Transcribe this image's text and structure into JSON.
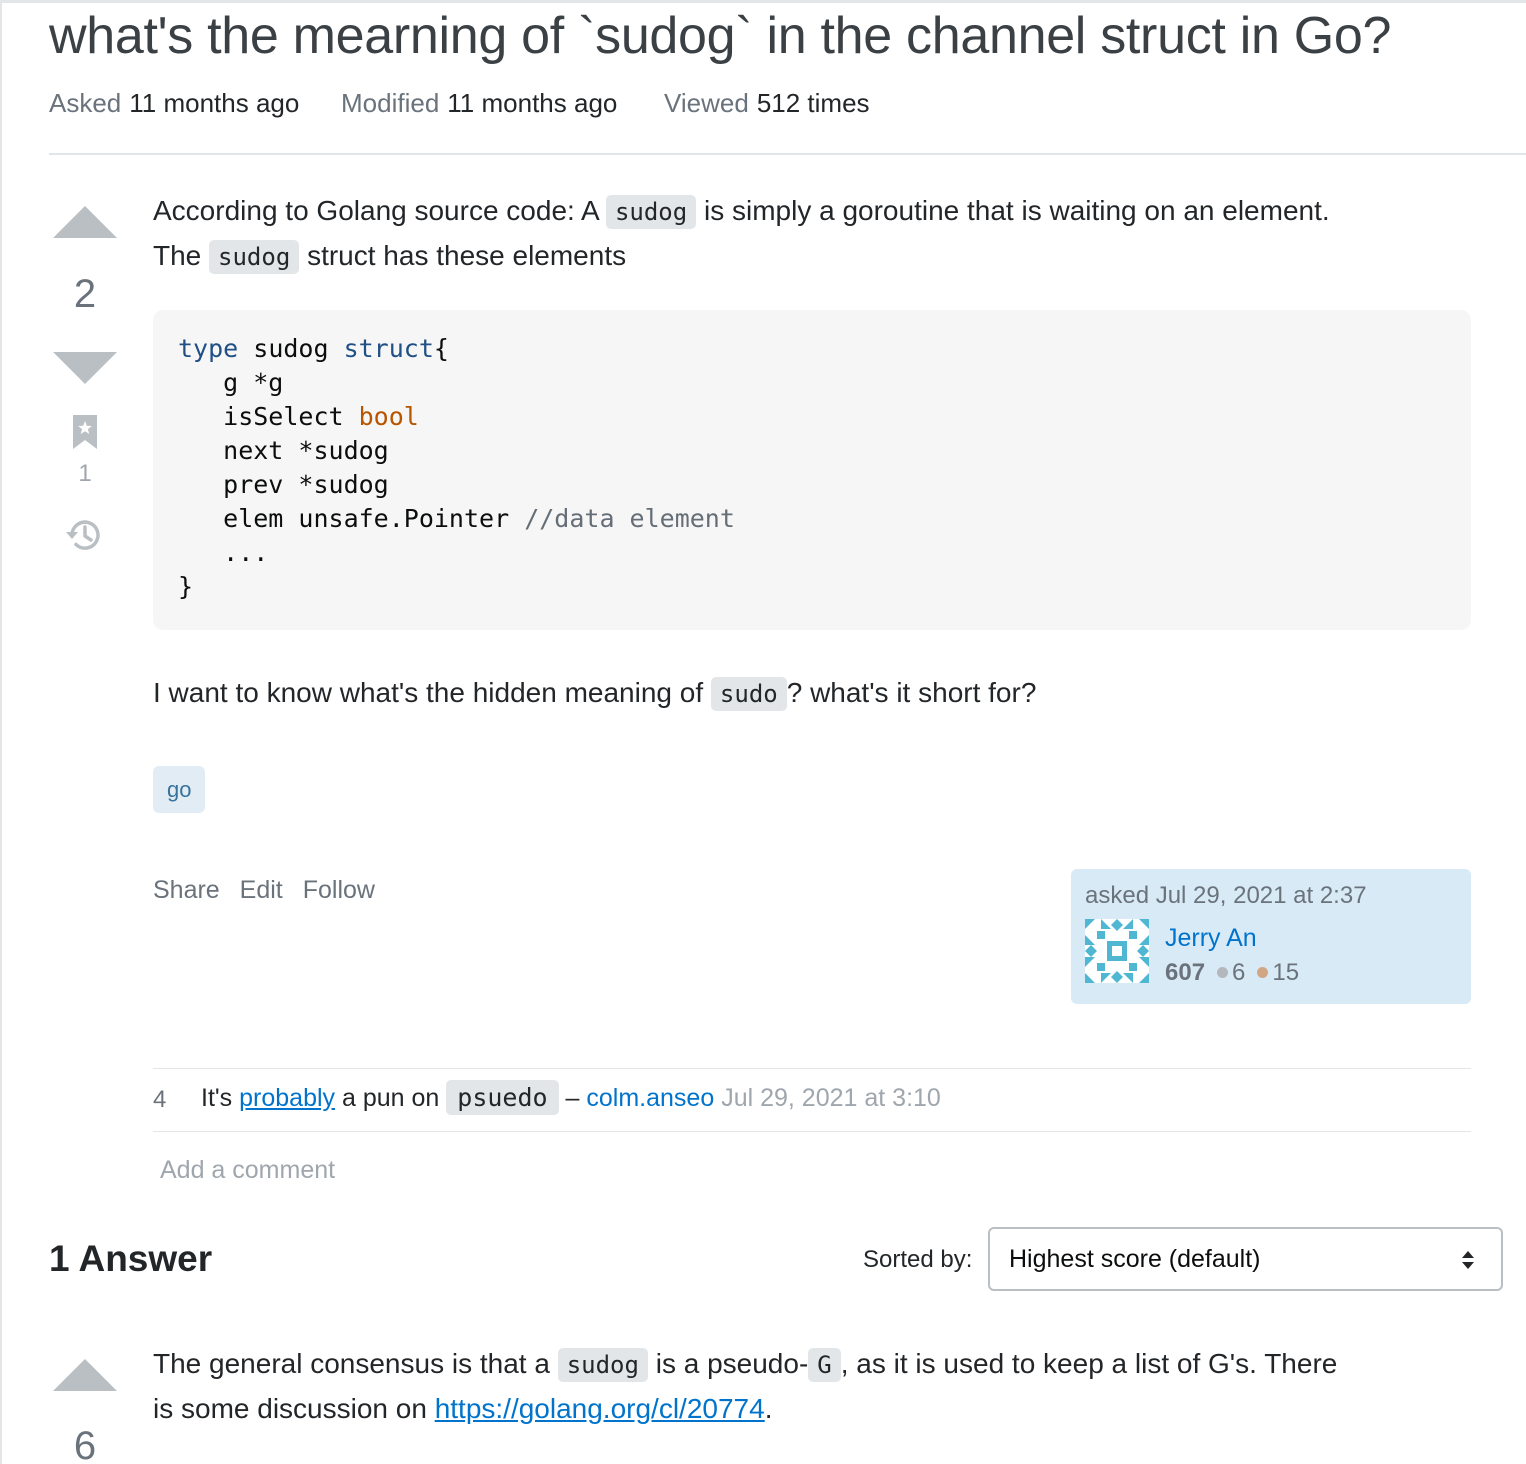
{
  "question": {
    "title": "what's the mearning of `sudog` in the channel struct in Go?",
    "meta": {
      "asked_label": "Asked",
      "asked_value": "11 months ago",
      "modified_label": "Modified",
      "modified_value": "11 months ago",
      "viewed_label": "Viewed",
      "viewed_value": "512 times"
    },
    "vote_count": "2",
    "bookmark_count": "1",
    "body": {
      "p1_a": "According to Golang source code: A",
      "p1_code": "sudog",
      "p1_b": "is simply a goroutine that is waiting on an element.",
      "p2_a": "The",
      "p2_code": "sudog",
      "p2_b": "struct has these elements",
      "code": {
        "l1_kw1": "type",
        "l1_name": " sudog ",
        "l1_kw2": "struct",
        "l1_end": "{",
        "l2": "   g *g",
        "l3_a": "   isSelect ",
        "l3_type": "bool",
        "l4": "   next *sudog",
        "l5": "   prev *sudog",
        "l6_a": "   elem unsafe.Pointer ",
        "l6_comment": "//data element",
        "l7": "   ...",
        "l8": "}"
      },
      "p3_a": "I want to know what's the hidden meaning of",
      "p3_code": "sudo",
      "p3_b": "? what's it short for?"
    },
    "tags": [
      "go"
    ],
    "menu": {
      "share": "Share",
      "edit": "Edit",
      "follow": "Follow"
    },
    "owner": {
      "asked_time": "asked Jul 29, 2021 at 2:37",
      "name": "Jerry An",
      "reputation": "607",
      "silver": "6",
      "bronze": "15",
      "colors": {
        "silver": "#b4b8bc",
        "bronze": "#d1a684"
      }
    },
    "comments": [
      {
        "score": "4",
        "text_a": "It's",
        "link": "probably",
        "text_b": "a pun on",
        "code": "psuedo",
        "dash": "–",
        "author": "colm.anseo",
        "time": "Jul 29, 2021 at 3:10"
      }
    ],
    "add_comment": "Add a comment"
  },
  "answers": {
    "heading": "1 Answer",
    "sort_label": "Sorted by:",
    "sort_value": "Highest score (default)",
    "items": [
      {
        "vote_count": "6",
        "p1_a": "The general consensus is that a",
        "p1_code": "sudog",
        "p1_b": "is a pseudo-",
        "p1_code2": "G",
        "p1_c": ", as it is used to keep a list of G's. There",
        "p2_a": "is some discussion on",
        "p2_link": "https://golang.org/cl/20774",
        "p2_b": "."
      }
    ]
  },
  "icons": [
    "upvote-arrow-icon",
    "downvote-arrow-icon",
    "bookmark-icon",
    "history-icon",
    "identicon-avatar",
    "sort-arrows-icon"
  ],
  "colors": {
    "accent": "#0074cc",
    "tag_bg": "#e1ecf4",
    "tag_text": "#39739d",
    "owner_card_bg": "#d9eaf7"
  }
}
